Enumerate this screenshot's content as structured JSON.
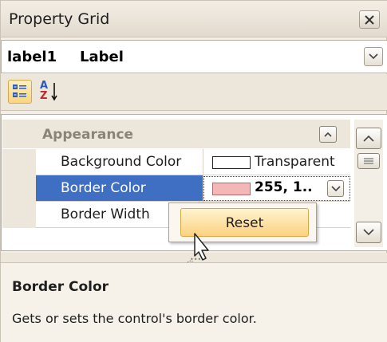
{
  "window": {
    "title": "Property Grid"
  },
  "selector": {
    "name": "label1",
    "type": "Label"
  },
  "toolbar": {
    "categorized": "categorized-view",
    "alphabetical": "alphabetical-sort"
  },
  "grid": {
    "category": "Appearance",
    "properties": [
      {
        "name": "Background Color",
        "value": "Transparent",
        "swatch_color": "#ffffff"
      },
      {
        "name": "Border Color",
        "value": "255, 1..",
        "swatch_color": "#f4b7b7",
        "selected": true
      },
      {
        "name": "Border Width",
        "value": ""
      }
    ]
  },
  "context_menu": {
    "items": [
      {
        "label": "Reset"
      }
    ]
  },
  "description": {
    "title": "Border Color",
    "text": "Gets or sets the control's border color."
  },
  "colors": {
    "selection": "#3f6fc2",
    "menu_highlight": "#fcd17f",
    "panel_bg": "#f4efe6"
  }
}
